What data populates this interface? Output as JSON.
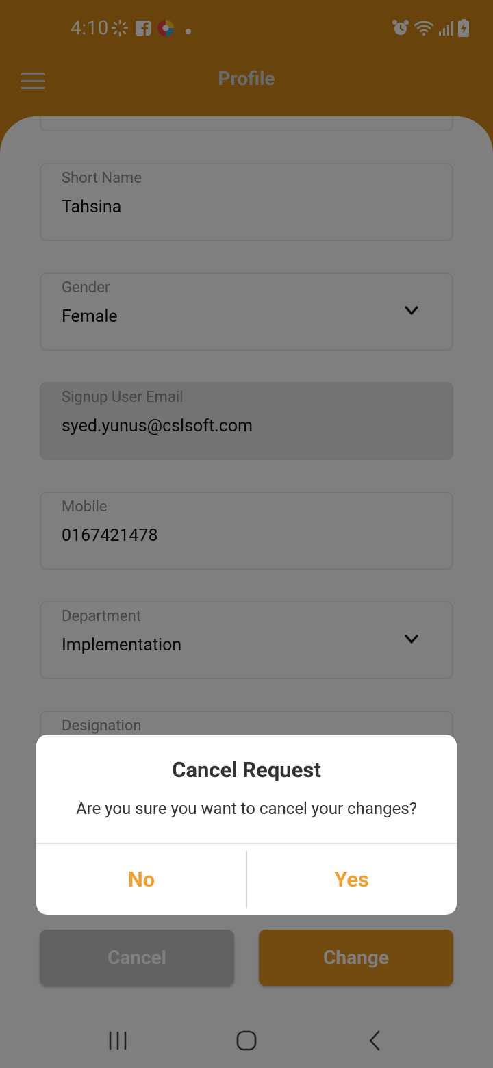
{
  "status_bar": {
    "time": "4:10",
    "left_icons": [
      "sync-icon",
      "facebook-icon",
      "browser-icon",
      "notification-dot-icon"
    ],
    "right_icons": [
      "alarm-icon",
      "wifi-icon",
      "signal-icon",
      "battery-charging-icon"
    ]
  },
  "app_bar": {
    "title": "Profile",
    "menu_icon": "hamburger-menu-icon"
  },
  "form": {
    "fields": [
      {
        "label": "Short Name",
        "value": "Tahsina",
        "type": "text"
      },
      {
        "label": "Gender",
        "value": "Female",
        "type": "dropdown"
      },
      {
        "label": "Signup User Email",
        "value": "syed.yunus@cslsoft.com",
        "type": "text",
        "disabled": true
      },
      {
        "label": "Mobile",
        "value": "0167421478",
        "type": "text"
      },
      {
        "label": "Department",
        "value": "Implementation",
        "type": "dropdown"
      },
      {
        "label": "Designation",
        "value": "",
        "type": "text"
      }
    ],
    "cancel_label": "Cancel",
    "change_label": "Change"
  },
  "dialog": {
    "title": "Cancel Request",
    "message": "Are you sure you want to cancel your changes?",
    "no_label": "No",
    "yes_label": "Yes"
  },
  "nav_bar": {
    "icons": [
      "recent-apps-icon",
      "home-icon",
      "back-icon"
    ]
  },
  "colors": {
    "primary": "#d08818",
    "accent": "#f0a030",
    "dialog_button_text": "#f0a030"
  }
}
